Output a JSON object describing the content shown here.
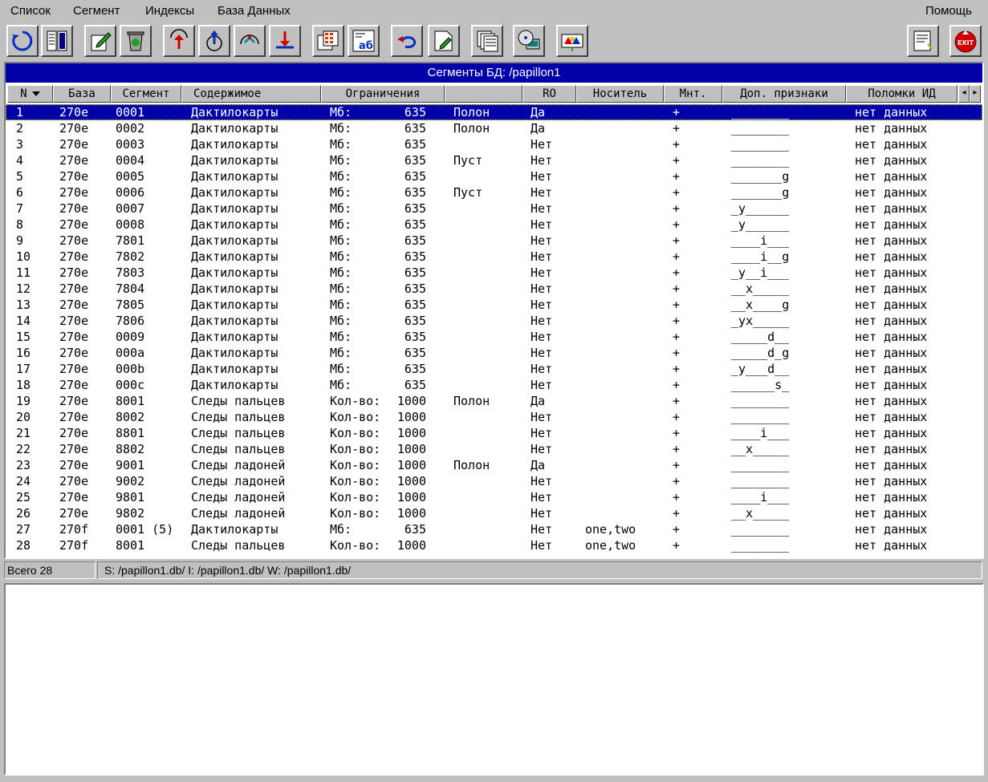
{
  "menu": {
    "items": [
      {
        "label": "Список"
      },
      {
        "label": "Сегмент"
      },
      {
        "label": "Индексы"
      },
      {
        "label": "База Данных"
      }
    ],
    "help": "Помощь"
  },
  "toolbar": {
    "buttons": [
      {
        "icon": "refresh-icon"
      },
      {
        "icon": "columns-icon"
      },
      {
        "icon": "edit-icon"
      },
      {
        "icon": "recycle-bin-icon"
      },
      {
        "icon": "arrow-up-icon"
      },
      {
        "icon": "disk-up-icon"
      },
      {
        "icon": "arrow-arc-icon"
      },
      {
        "icon": "arrow-down-icon"
      },
      {
        "icon": "grid-copy-icon"
      },
      {
        "icon": "text-ab-icon"
      },
      {
        "icon": "undo-icon"
      },
      {
        "icon": "document-edit-icon"
      },
      {
        "icon": "stack-icon"
      },
      {
        "icon": "disk-computer-icon"
      },
      {
        "icon": "network-icon"
      },
      {
        "icon": "notes-icon"
      },
      {
        "icon": "exit-icon",
        "text": "EXIT"
      }
    ]
  },
  "grid": {
    "title": "Сегменты БД: /papillon1",
    "columns": [
      "N",
      "База",
      "Сегмент",
      "Содержимое",
      "Ограничения",
      "",
      "RO",
      "Носитель",
      "Мнт.",
      "Доп. признаки",
      "Поломки ИД"
    ],
    "rows": [
      [
        "1",
        "270e",
        "0001",
        "Дактилокарты",
        "Мб:",
        "635",
        "Полон",
        "Да",
        "",
        "+",
        "________",
        "нет данных"
      ],
      [
        "2",
        "270e",
        "0002",
        "Дактилокарты",
        "Мб:",
        "635",
        "Полон",
        "Да",
        "",
        "+",
        "________",
        "нет данных"
      ],
      [
        "3",
        "270e",
        "0003",
        "Дактилокарты",
        "Мб:",
        "635",
        "",
        "Нет",
        "",
        "+",
        "________",
        "нет данных"
      ],
      [
        "4",
        "270e",
        "0004",
        "Дактилокарты",
        "Мб:",
        "635",
        "Пуст",
        "Нет",
        "",
        "+",
        "________",
        "нет данных"
      ],
      [
        "5",
        "270e",
        "0005",
        "Дактилокарты",
        "Мб:",
        "635",
        "",
        "Нет",
        "",
        "+",
        "_______g",
        "нет данных"
      ],
      [
        "6",
        "270e",
        "0006",
        "Дактилокарты",
        "Мб:",
        "635",
        "Пуст",
        "Нет",
        "",
        "+",
        "_______g",
        "нет данных"
      ],
      [
        "7",
        "270e",
        "0007",
        "Дактилокарты",
        "Мб:",
        "635",
        "",
        "Нет",
        "",
        "+",
        "_y______",
        "нет данных"
      ],
      [
        "8",
        "270e",
        "0008",
        "Дактилокарты",
        "Мб:",
        "635",
        "",
        "Нет",
        "",
        "+",
        "_y______",
        "нет данных"
      ],
      [
        "9",
        "270e",
        "7801",
        "Дактилокарты",
        "Мб:",
        "635",
        "",
        "Нет",
        "",
        "+",
        "____i___",
        "нет данных"
      ],
      [
        "10",
        "270e",
        "7802",
        "Дактилокарты",
        "Мб:",
        "635",
        "",
        "Нет",
        "",
        "+",
        "____i__g",
        "нет данных"
      ],
      [
        "11",
        "270e",
        "7803",
        "Дактилокарты",
        "Мб:",
        "635",
        "",
        "Нет",
        "",
        "+",
        "_y__i___",
        "нет данных"
      ],
      [
        "12",
        "270e",
        "7804",
        "Дактилокарты",
        "Мб:",
        "635",
        "",
        "Нет",
        "",
        "+",
        "__x_____",
        "нет данных"
      ],
      [
        "13",
        "270e",
        "7805",
        "Дактилокарты",
        "Мб:",
        "635",
        "",
        "Нет",
        "",
        "+",
        "__x____g",
        "нет данных"
      ],
      [
        "14",
        "270e",
        "7806",
        "Дактилокарты",
        "Мб:",
        "635",
        "",
        "Нет",
        "",
        "+",
        "_yx_____",
        "нет данных"
      ],
      [
        "15",
        "270e",
        "0009",
        "Дактилокарты",
        "Мб:",
        "635",
        "",
        "Нет",
        "",
        "+",
        "_____d__",
        "нет данных"
      ],
      [
        "16",
        "270e",
        "000a",
        "Дактилокарты",
        "Мб:",
        "635",
        "",
        "Нет",
        "",
        "+",
        "_____d_g",
        "нет данных"
      ],
      [
        "17",
        "270e",
        "000b",
        "Дактилокарты",
        "Мб:",
        "635",
        "",
        "Нет",
        "",
        "+",
        "_y___d__",
        "нет данных"
      ],
      [
        "18",
        "270e",
        "000c",
        "Дактилокарты",
        "Мб:",
        "635",
        "",
        "Нет",
        "",
        "+",
        "______s_",
        "нет данных"
      ],
      [
        "19",
        "270e",
        "8001",
        "Следы пальцев",
        "Кол-во:",
        "1000",
        "Полон",
        "Да",
        "",
        "+",
        "________",
        "нет данных"
      ],
      [
        "20",
        "270e",
        "8002",
        "Следы пальцев",
        "Кол-во:",
        "1000",
        "",
        "Нет",
        "",
        "+",
        "________",
        "нет данных"
      ],
      [
        "21",
        "270e",
        "8801",
        "Следы пальцев",
        "Кол-во:",
        "1000",
        "",
        "Нет",
        "",
        "+",
        "____i___",
        "нет данных"
      ],
      [
        "22",
        "270e",
        "8802",
        "Следы пальцев",
        "Кол-во:",
        "1000",
        "",
        "Нет",
        "",
        "+",
        "__x_____",
        "нет данных"
      ],
      [
        "23",
        "270e",
        "9001",
        "Следы ладоней",
        "Кол-во:",
        "1000",
        "Полон",
        "Да",
        "",
        "+",
        "________",
        "нет данных"
      ],
      [
        "24",
        "270e",
        "9002",
        "Следы ладоней",
        "Кол-во:",
        "1000",
        "",
        "Нет",
        "",
        "+",
        "________",
        "нет данных"
      ],
      [
        "25",
        "270e",
        "9801",
        "Следы ладоней",
        "Кол-во:",
        "1000",
        "",
        "Нет",
        "",
        "+",
        "____i___",
        "нет данных"
      ],
      [
        "26",
        "270e",
        "9802",
        "Следы ладоней",
        "Кол-во:",
        "1000",
        "",
        "Нет",
        "",
        "+",
        "__x_____",
        "нет данных"
      ],
      [
        "27",
        "270f",
        "0001 (5)",
        "Дактилокарты",
        "Мб:",
        "635",
        "",
        "Нет",
        "one,two",
        "+",
        "________",
        "нет данных"
      ],
      [
        "28",
        "270f",
        "8001",
        "Следы пальцев",
        "Кол-во:",
        "1000",
        "",
        "Нет",
        "one,two",
        "+",
        "________",
        "нет данных"
      ]
    ]
  },
  "status": {
    "total": "Всего 28",
    "paths": "S: /papillon1.db/  I: /papillon1.db/  W: /papillon1.db/"
  },
  "colors": {
    "face": "#c0c0c0",
    "selection": "#0000a8",
    "exit": "#d00000"
  }
}
